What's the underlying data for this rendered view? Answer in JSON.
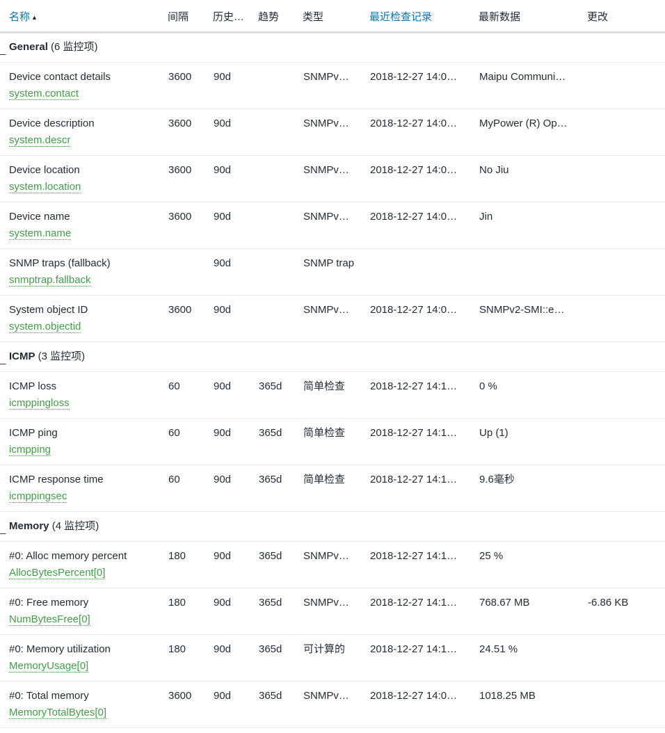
{
  "table": {
    "headers": {
      "name": "名称",
      "interval": "间隔",
      "history": "历史…",
      "trends": "趋势",
      "type": "类型",
      "last_check": "最近检查记录",
      "latest_data": "最新数据",
      "change": "更改"
    },
    "sort_icon": "sort-ascending-icon",
    "link_color": "#0275b8",
    "key_color": "#429e47",
    "groups": [
      {
        "toggle": "_",
        "name": "General",
        "count": "(6 监控项)",
        "items": [
          {
            "name": "Device contact details",
            "key": "system.contact",
            "interval": "3600",
            "history": "90d",
            "trends": "",
            "type": "SNMPv…",
            "last_check": "2018-12-27 14:0…",
            "latest": "Maipu Communi…",
            "change": ""
          },
          {
            "name": "Device description",
            "key": "system.descr",
            "interval": "3600",
            "history": "90d",
            "trends": "",
            "type": "SNMPv…",
            "last_check": "2018-12-27 14:0…",
            "latest": "MyPower (R) Op…",
            "change": ""
          },
          {
            "name": "Device location",
            "key": "system.location",
            "interval": "3600",
            "history": "90d",
            "trends": "",
            "type": "SNMPv…",
            "last_check": "2018-12-27 14:0…",
            "latest": "No      Jiu",
            "change": ""
          },
          {
            "name": "Device name",
            "key": "system.name",
            "interval": "3600",
            "history": "90d",
            "trends": "",
            "type": "SNMPv…",
            "last_check": "2018-12-27 14:0…",
            "latest": "Jin",
            "change": ""
          },
          {
            "name": "SNMP traps (fallback)",
            "key": "snmptrap.fallback",
            "interval": "",
            "history": "90d",
            "trends": "",
            "type": "SNMP trap",
            "last_check": "",
            "latest": "",
            "change": ""
          },
          {
            "name": "System object ID",
            "key": "system.objectid",
            "interval": "3600",
            "history": "90d",
            "trends": "",
            "type": "SNMPv…",
            "last_check": "2018-12-27 14:0…",
            "latest": "SNMPv2-SMI::e…",
            "change": ""
          }
        ]
      },
      {
        "toggle": "_",
        "name": "ICMP",
        "count": "(3 监控项)",
        "items": [
          {
            "name": "ICMP loss",
            "key": "icmppingloss",
            "interval": "60",
            "history": "90d",
            "trends": "365d",
            "type": "简单检查",
            "last_check": "2018-12-27 14:1…",
            "latest": "0 %",
            "change": ""
          },
          {
            "name": "ICMP ping",
            "key": "icmpping",
            "interval": "60",
            "history": "90d",
            "trends": "365d",
            "type": "简单检查",
            "last_check": "2018-12-27 14:1…",
            "latest": "Up (1)",
            "change": ""
          },
          {
            "name": "ICMP response time",
            "key": "icmppingsec",
            "interval": "60",
            "history": "90d",
            "trends": "365d",
            "type": "简单检查",
            "last_check": "2018-12-27 14:1…",
            "latest": "9.6毫秒",
            "change": ""
          }
        ]
      },
      {
        "toggle": "_",
        "name": "Memory",
        "count": "(4 监控项)",
        "items": [
          {
            "name": "#0: Alloc memory percent",
            "key": "AllocBytesPercent[0]",
            "interval": "180",
            "history": "90d",
            "trends": "365d",
            "type": "SNMPv…",
            "last_check": "2018-12-27 14:1…",
            "latest": "25 %",
            "change": ""
          },
          {
            "name": "#0: Free memory",
            "key": "NumBytesFree[0]",
            "interval": "180",
            "history": "90d",
            "trends": "365d",
            "type": "SNMPv…",
            "last_check": "2018-12-27 14:1…",
            "latest": "768.67 MB",
            "change": "-6.86 KB"
          },
          {
            "name": "#0: Memory utilization",
            "key": "MemoryUsage[0]",
            "interval": "180",
            "history": "90d",
            "trends": "365d",
            "type": "可计算的",
            "last_check": "2018-12-27 14:1…",
            "latest": "24.51 %",
            "change": ""
          },
          {
            "name": "#0: Total memory",
            "key": "MemoryTotalBytes[0]",
            "interval": "3600",
            "history": "90d",
            "trends": "365d",
            "type": "SNMPv…",
            "last_check": "2018-12-27 14:0…",
            "latest": "1018.25 MB",
            "change": ""
          }
        ]
      }
    ]
  }
}
